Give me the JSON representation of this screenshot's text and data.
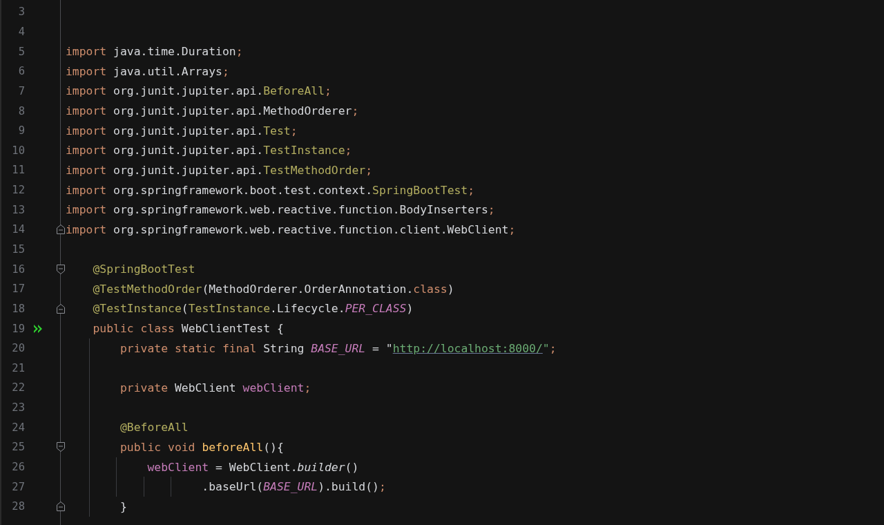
{
  "editor": {
    "lines": [
      {
        "number": "3"
      },
      {
        "number": "4"
      },
      {
        "number": "5",
        "tokens": [
          {
            "text": "import",
            "kind": "keyword"
          },
          {
            "text": " java.time.Duration",
            "kind": "plain"
          },
          {
            "text": ";",
            "kind": "keyword"
          }
        ]
      },
      {
        "number": "6",
        "tokens": [
          {
            "text": "import",
            "kind": "keyword"
          },
          {
            "text": " java.util.Arrays",
            "kind": "plain"
          },
          {
            "text": ";",
            "kind": "keyword"
          }
        ]
      },
      {
        "number": "7",
        "tokens": [
          {
            "text": "import",
            "kind": "keyword"
          },
          {
            "text": " org.junit.jupiter.api.",
            "kind": "plain"
          },
          {
            "text": "BeforeAll",
            "kind": "annotation"
          },
          {
            "text": ";",
            "kind": "keyword"
          }
        ]
      },
      {
        "number": "8",
        "tokens": [
          {
            "text": "import",
            "kind": "keyword"
          },
          {
            "text": " org.junit.jupiter.api.MethodOrderer",
            "kind": "plain"
          },
          {
            "text": ";",
            "kind": "keyword"
          }
        ]
      },
      {
        "number": "9",
        "tokens": [
          {
            "text": "import",
            "kind": "keyword"
          },
          {
            "text": " org.junit.jupiter.api.",
            "kind": "plain"
          },
          {
            "text": "Test",
            "kind": "annotation"
          },
          {
            "text": ";",
            "kind": "keyword"
          }
        ]
      },
      {
        "number": "10",
        "tokens": [
          {
            "text": "import",
            "kind": "keyword"
          },
          {
            "text": " org.junit.jupiter.api.",
            "kind": "plain"
          },
          {
            "text": "TestInstance",
            "kind": "annotation"
          },
          {
            "text": ";",
            "kind": "keyword"
          }
        ]
      },
      {
        "number": "11",
        "tokens": [
          {
            "text": "import",
            "kind": "keyword"
          },
          {
            "text": " org.junit.jupiter.api.",
            "kind": "plain"
          },
          {
            "text": "TestMethodOrder",
            "kind": "annotation"
          },
          {
            "text": ";",
            "kind": "keyword"
          }
        ]
      },
      {
        "number": "12",
        "tokens": [
          {
            "text": "import",
            "kind": "keyword"
          },
          {
            "text": " org.springframework.boot.test.context.",
            "kind": "plain"
          },
          {
            "text": "SpringBootTest",
            "kind": "annotation"
          },
          {
            "text": ";",
            "kind": "keyword"
          }
        ]
      },
      {
        "number": "13",
        "tokens": [
          {
            "text": "import",
            "kind": "keyword"
          },
          {
            "text": " org.springframework.web.reactive.function.BodyInserters",
            "kind": "plain"
          },
          {
            "text": ";",
            "kind": "keyword"
          }
        ]
      },
      {
        "number": "14",
        "fold_end": true,
        "tokens": [
          {
            "text": "import",
            "kind": "keyword"
          },
          {
            "text": " org.springframework.web.reactive.function.client.WebClient",
            "kind": "plain"
          },
          {
            "text": ";",
            "kind": "keyword"
          }
        ]
      },
      {
        "number": "15"
      },
      {
        "number": "16",
        "fold_start": true,
        "tokens": [
          {
            "text": "    @SpringBootTest",
            "kind": "annotation"
          }
        ]
      },
      {
        "number": "17",
        "tokens": [
          {
            "text": "    @TestMethodOrder",
            "kind": "annotation"
          },
          {
            "text": "(MethodOrderer.OrderAnnotation.",
            "kind": "plain"
          },
          {
            "text": "class",
            "kind": "keyword"
          },
          {
            "text": ")",
            "kind": "plain"
          }
        ]
      },
      {
        "number": "18",
        "fold_end": true,
        "tokens": [
          {
            "text": "    @TestInstance",
            "kind": "annotation"
          },
          {
            "text": "(",
            "kind": "plain"
          },
          {
            "text": "TestInstance",
            "kind": "annotation"
          },
          {
            "text": ".Lifecycle.",
            "kind": "plain"
          },
          {
            "text": "PER_CLASS",
            "kind": "constant"
          },
          {
            "text": ")",
            "kind": "plain"
          }
        ]
      },
      {
        "number": "19",
        "run_button": true,
        "tokens": [
          {
            "text": "    public class",
            "kind": "keyword"
          },
          {
            "text": " WebClientTest {",
            "kind": "plain"
          }
        ]
      },
      {
        "number": "20",
        "tokens": [
          {
            "text": "        private static final",
            "kind": "keyword"
          },
          {
            "text": " String ",
            "kind": "plain"
          },
          {
            "text": "BASE_URL",
            "kind": "constant"
          },
          {
            "text": " = \"",
            "kind": "plain"
          },
          {
            "text": "http://localhost:8000/",
            "kind": "link"
          },
          {
            "text": "\"",
            "kind": "string"
          },
          {
            "text": ";",
            "kind": "keyword"
          }
        ]
      },
      {
        "number": "21"
      },
      {
        "number": "22",
        "tokens": [
          {
            "text": "        private",
            "kind": "keyword"
          },
          {
            "text": " WebClient ",
            "kind": "plain"
          },
          {
            "text": "webClient",
            "kind": "field"
          },
          {
            "text": ";",
            "kind": "keyword"
          }
        ]
      },
      {
        "number": "23"
      },
      {
        "number": "24",
        "tokens": [
          {
            "text": "        @BeforeAll",
            "kind": "annotation"
          }
        ]
      },
      {
        "number": "25",
        "fold_start": true,
        "tokens": [
          {
            "text": "        public void ",
            "kind": "keyword"
          },
          {
            "text": "beforeAll",
            "kind": "method"
          },
          {
            "text": "(){",
            "kind": "plain"
          }
        ]
      },
      {
        "number": "26",
        "tokens": [
          {
            "text": "            webClient",
            "kind": "field"
          },
          {
            "text": " = WebClient.",
            "kind": "plain"
          },
          {
            "text": "builder",
            "kind": "static-call"
          },
          {
            "text": "()",
            "kind": "plain"
          }
        ]
      },
      {
        "number": "27",
        "tokens": [
          {
            "text": "                    .baseUrl(",
            "kind": "plain"
          },
          {
            "text": "BASE_URL",
            "kind": "constant"
          },
          {
            "text": ").build()",
            "kind": "plain"
          },
          {
            "text": ";",
            "kind": "keyword"
          }
        ]
      },
      {
        "number": "28",
        "fold_end": true,
        "tokens": [
          {
            "text": "        }",
            "kind": "plain"
          }
        ]
      }
    ]
  }
}
